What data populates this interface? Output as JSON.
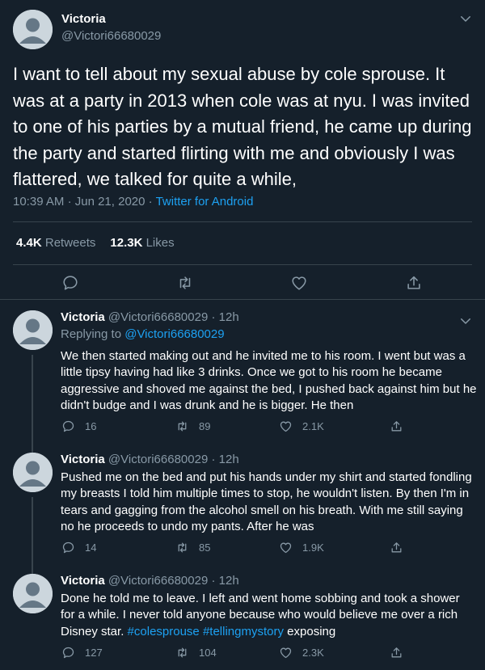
{
  "tweet": {
    "name": "Victoria",
    "handle": "@Victori66680029",
    "text": "I want to tell about my sexual abuse by cole sprouse. It was at a party in 2013 when cole was at nyu.  I was invited to one of his parties by a mutual friend, he came up during the party and started flirting with me and obviously I was flattered, we talked for quite a while,",
    "time": "10:39 AM",
    "date": "Jun 21, 2020",
    "dot": "·",
    "source": "Twitter for Android",
    "retweets_count": "4.4K",
    "retweets_label": "Retweets",
    "likes_count": "12.3K",
    "likes_label": "Likes"
  },
  "replies": [
    {
      "name": "Victoria",
      "handle": "@Victori66680029",
      "time": "12h",
      "dot": "·",
      "replying_label": "Replying to",
      "replying_handle": "@Victori66680029",
      "text": "We then started making out and he invited me to his room. I went but was a little tipsy having had like 3 drinks.  Once we got to his room he became aggressive and shoved me against the bed, I pushed back against him but he didn't budge and I was drunk and he is bigger. He then",
      "replies": "16",
      "retweets": "89",
      "likes": "2.1K"
    },
    {
      "name": "Victoria",
      "handle": "@Victori66680029",
      "time": "12h",
      "dot": "·",
      "text": "Pushed me on the bed and put his hands under my shirt and started fondling my breasts I told him multiple times to stop, he wouldn't listen.  By then I'm in tears and gagging from the alcohol smell on his breath. With me still saying no he proceeds to undo my pants. After he was",
      "replies": "14",
      "retweets": "85",
      "likes": "1.9K"
    },
    {
      "name": "Victoria",
      "handle": "@Victori66680029",
      "time": "12h",
      "dot": "·",
      "text_plain": "Done he told me to leave.  I left and went home sobbing and took a shower for a while. I never told anyone because who would believe me over a rich Disney star.",
      "hashtag1": "#colesprouse",
      "hashtag2": "#tellingmystory",
      "text_end": "exposing",
      "replies": "127",
      "retweets": "104",
      "likes": "2.3K"
    }
  ],
  "icons": {
    "avatar": "default-avatar-icon",
    "chevron": "chevron-down-icon",
    "reply": "reply-icon",
    "retweet": "retweet-icon",
    "like": "heart-icon",
    "share": "share-icon"
  },
  "colors": {
    "background": "#15202b",
    "text": "#ffffff",
    "muted": "#8899a6",
    "link": "#1da1f2",
    "border": "#38444d"
  }
}
